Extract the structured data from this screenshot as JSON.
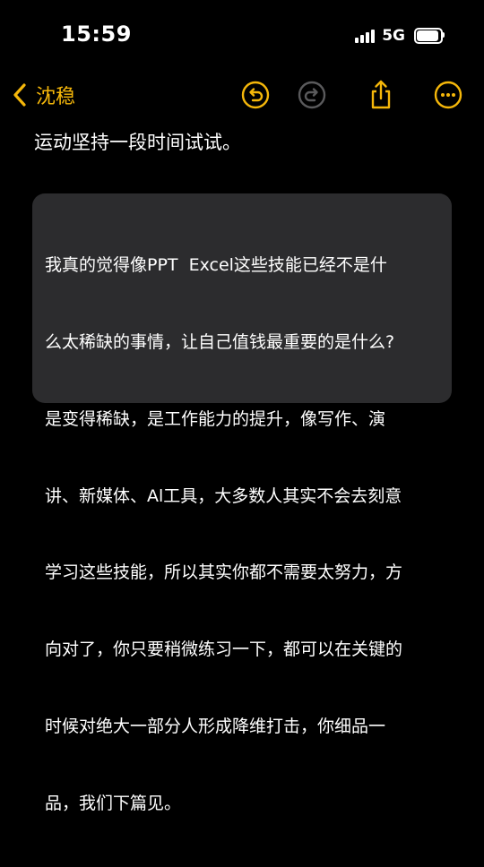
{
  "status_bar": {
    "time": "15:59",
    "network": "5G"
  },
  "nav": {
    "back_label": "沈稳",
    "icons": {
      "back": "chevron-left-icon",
      "undo": "undo-icon",
      "redo": "redo-icon",
      "share": "share-icon",
      "more": "more-icon"
    },
    "accent_color": "#f5b70a",
    "disabled_color": "#5a5a5c"
  },
  "note": {
    "intro_line": "运动坚持一段时间试试。",
    "quote_lines": [
      "我真的觉得像PPT  Excel这些技能已经不是什",
      "么太稀缺的事情，让自己值钱最重要的是什么?",
      "是变得稀缺，是工作能力的提升，像写作、演",
      "讲、新媒体、Al工具，大多数人其实不会去刻意",
      "学习这些技能，所以其实你都不需要太努力，方",
      "向对了，你只要稍微练习一下，都可以在关键的",
      "时候对绝大一部分人形成降维打击，你细品一",
      "品，我们下篇见。"
    ]
  }
}
